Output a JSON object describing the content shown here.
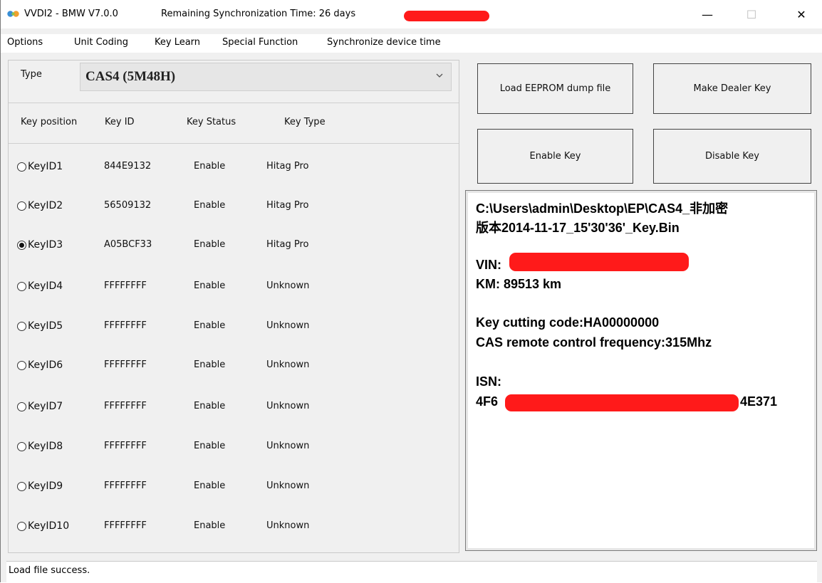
{
  "window": {
    "title": "VVDI2 - BMW V7.0.0",
    "sync_text": "Remaining Synchronization Time: 26 days",
    "controls": {
      "minimize": "—",
      "maximize": "☐",
      "close": "✕"
    }
  },
  "menu": {
    "items": [
      "Options",
      "Unit Coding",
      "Key Learn",
      "Special Function",
      "Synchronize device time"
    ]
  },
  "type_selector": {
    "label": "Type",
    "value": "CAS4 (5M48H)"
  },
  "table": {
    "headers": [
      "Key position",
      "Key ID",
      "Key Status",
      "Key Type"
    ],
    "rows": [
      {
        "position": "KeyID1",
        "id": "844E9132",
        "status": "Enable",
        "type": "Hitag Pro",
        "selected": false
      },
      {
        "position": "KeyID2",
        "id": "56509132",
        "status": "Enable",
        "type": "Hitag Pro",
        "selected": false
      },
      {
        "position": "KeyID3",
        "id": "A05BCF33",
        "status": "Enable",
        "type": "Hitag Pro",
        "selected": true
      },
      {
        "position": "KeyID4",
        "id": "FFFFFFFF",
        "status": "Enable",
        "type": "Unknown",
        "selected": false
      },
      {
        "position": "KeyID5",
        "id": "FFFFFFFF",
        "status": "Enable",
        "type": "Unknown",
        "selected": false
      },
      {
        "position": "KeyID6",
        "id": "FFFFFFFF",
        "status": "Enable",
        "type": "Unknown",
        "selected": false
      },
      {
        "position": "KeyID7",
        "id": "FFFFFFFF",
        "status": "Enable",
        "type": "Unknown",
        "selected": false
      },
      {
        "position": "KeyID8",
        "id": "FFFFFFFF",
        "status": "Enable",
        "type": "Unknown",
        "selected": false
      },
      {
        "position": "KeyID9",
        "id": "FFFFFFFF",
        "status": "Enable",
        "type": "Unknown",
        "selected": false
      },
      {
        "position": "KeyID10",
        "id": "FFFFFFFF",
        "status": "Enable",
        "type": "Unknown",
        "selected": false
      }
    ]
  },
  "actions": {
    "load_eeprom": "Load EEPROM dump file",
    "make_dealer_key": "Make Dealer Key",
    "enable_key": "Enable Key",
    "disable_key": "Disable Key"
  },
  "info": {
    "file_path_line1": "C:\\Users\\admin\\Desktop\\EP\\CAS4_非加密",
    "file_path_line2": "版本2014-11-17_15'30'36'_Key.Bin",
    "vin_label": "VIN:",
    "km": "KM:  89513 km",
    "key_cutting_code": "Key cutting code:HA00000000",
    "remote_frequency": "CAS remote control frequency:315Mhz",
    "isn_label": "ISN:",
    "isn_prefix": "4F6",
    "isn_suffix": "4E371"
  },
  "status": {
    "message": "Load file success."
  },
  "colors": {
    "redaction": "#ff1a1a",
    "window_bg": "#f0f0f0"
  }
}
